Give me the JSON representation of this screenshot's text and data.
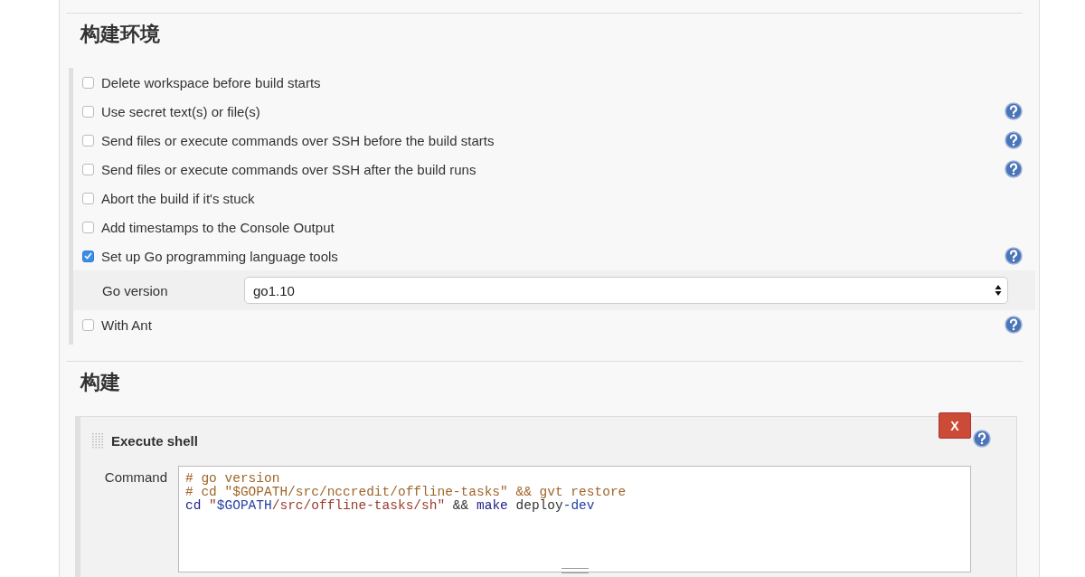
{
  "sections": [
    {
      "title": "构建环境",
      "kind": "options",
      "options": [
        {
          "label": "Delete workspace before build starts",
          "checked": false,
          "help": false
        },
        {
          "label": "Use secret text(s) or file(s)",
          "checked": false,
          "help": true
        },
        {
          "label": "Send files or execute commands over SSH before the build starts",
          "checked": false,
          "help": true
        },
        {
          "label": "Send files or execute commands over SSH after the build runs",
          "checked": false,
          "help": true
        },
        {
          "label": "Abort the build if it's stuck",
          "checked": false,
          "help": false
        },
        {
          "label": "Add timestamps to the Console Output",
          "checked": false,
          "help": false
        },
        {
          "label": "Set up Go programming language tools",
          "checked": true,
          "help": true,
          "field": {
            "label": "Go version",
            "value": "go1.10"
          }
        },
        {
          "label": "With Ant",
          "checked": false,
          "help": true
        }
      ]
    },
    {
      "title": "构建",
      "kind": "steps",
      "steps": [
        {
          "title": "Execute shell",
          "delete_label": "X",
          "field_label": "Command",
          "code": [
            [
              {
                "kind": "comment",
                "text": "# go version"
              }
            ],
            [
              {
                "kind": "comment",
                "text": "# cd \"$GOPATH/src/nccredit/offline-tasks\" && gvt restore"
              }
            ],
            [
              {
                "kind": "keyword",
                "text": "cd "
              },
              {
                "kind": "string",
                "text": "\""
              },
              {
                "kind": "variable",
                "text": "$GOPATH"
              },
              {
                "kind": "string",
                "text": "/src/offline-tasks/sh\""
              },
              {
                "kind": "plain",
                "text": " && "
              },
              {
                "kind": "keyword",
                "text": "make"
              },
              {
                "kind": "plain",
                "text": " deploy"
              },
              {
                "kind": "variable",
                "text": "-dev"
              }
            ]
          ]
        }
      ]
    }
  ]
}
